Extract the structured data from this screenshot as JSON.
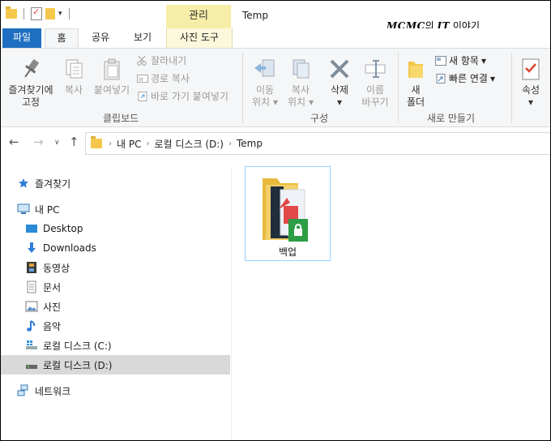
{
  "window": {
    "title": "Temp",
    "context_tab": "관리",
    "brand_prefix": "MCMC",
    "brand_mid": "의 ",
    "brand_it": "IT",
    "brand_suffix": " 이야기"
  },
  "tabs": {
    "file": "파일",
    "home": "홈",
    "share": "공유",
    "view": "보기",
    "photo_tool": "사진 도구"
  },
  "ribbon": {
    "clipboard": {
      "pin_line1": "즐겨찾기에",
      "pin_line2": "고정",
      "copy": "복사",
      "paste": "붙여넣기",
      "cut": "잘라내기",
      "copy_path": "경로 복사",
      "paste_shortcut": "바로 가기 붙여넣기",
      "group": "클립보드"
    },
    "organize": {
      "move_line1": "이동",
      "move_line2": "위치",
      "copy_line1": "복사",
      "copy_line2": "위치",
      "delete": "삭제",
      "rename_line1": "이름",
      "rename_line2": "바꾸기",
      "group": "구성"
    },
    "new": {
      "folder_line1": "새",
      "folder_line2": "폴더",
      "new_item": "새 항목",
      "easy_access": "빠른 연결",
      "group": "새로 만들기"
    },
    "open": {
      "properties": "속성"
    }
  },
  "address": {
    "crumbs": [
      "내 PC",
      "로컬 디스크 (D:)",
      "Temp"
    ]
  },
  "nav": {
    "quick_access": "즐겨찾기",
    "this_pc": "내 PC",
    "desktop": "Desktop",
    "downloads": "Downloads",
    "videos": "동영상",
    "documents": "문서",
    "pictures": "사진",
    "music": "음악",
    "drive_c": "로컬 디스크 (C:)",
    "drive_d": "로컬 디스크 (D:)",
    "network": "네트워크"
  },
  "files": [
    {
      "name": "백업"
    }
  ],
  "colors": {
    "file_tab": "#1e6fc1",
    "manage_tab": "#f6eea8",
    "selection": "#d9d9d9",
    "tile_border": "#99d1ff"
  }
}
